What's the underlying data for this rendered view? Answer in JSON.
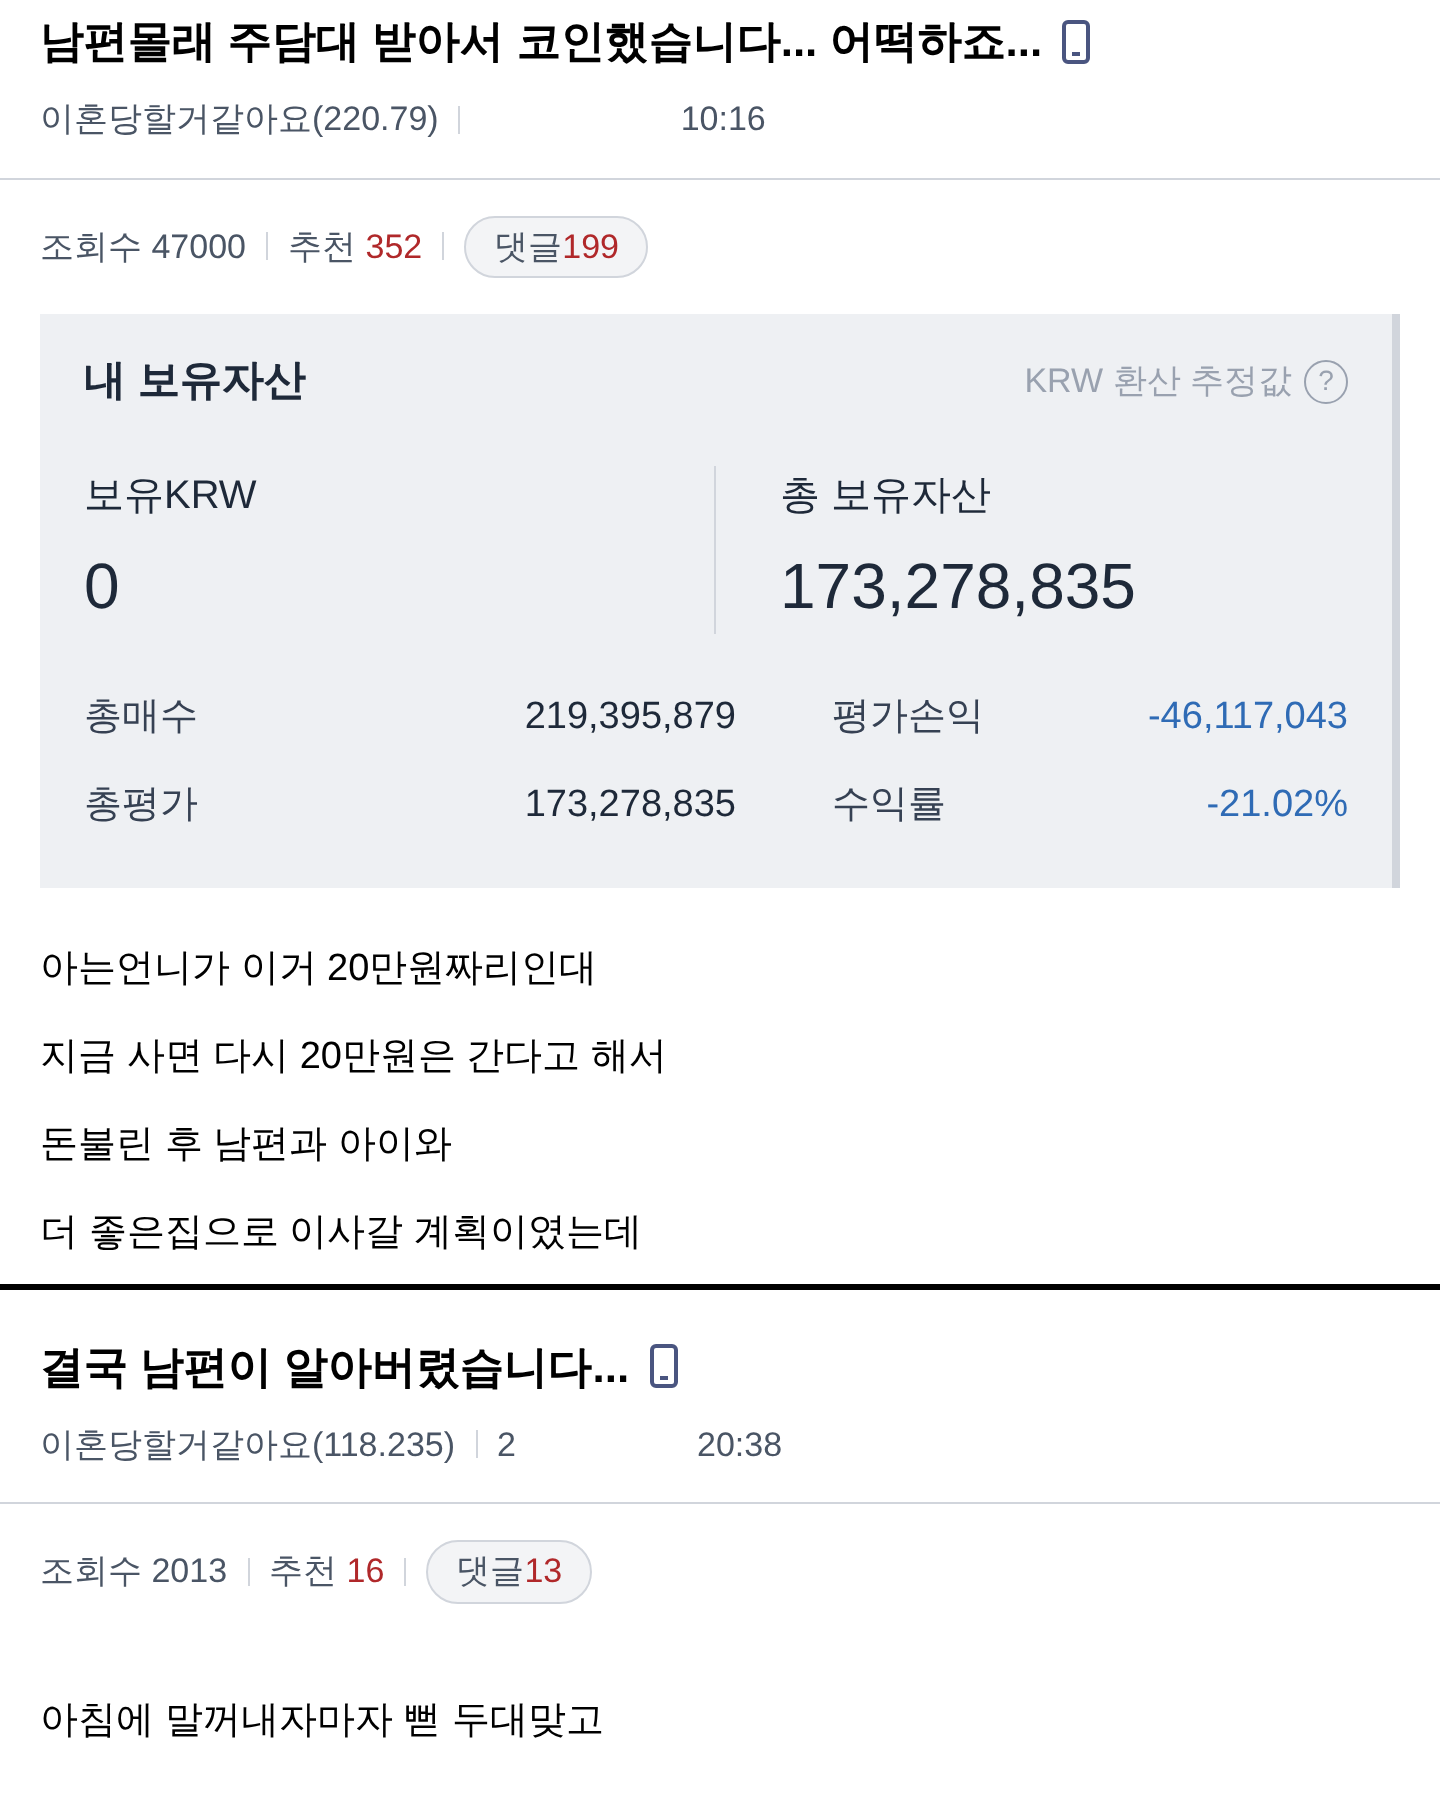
{
  "posts": [
    {
      "title": "남편몰래 주담대 받아서 코인했습니다... 어떡하죠...",
      "author": "이혼당할거같아요(220.79)",
      "time": "10:16",
      "views_label": "조회수",
      "views": "47000",
      "likes_label": "추천",
      "likes": "352",
      "comments_label": "댓글",
      "comments": "199",
      "asset_card": {
        "title": "내 보유자산",
        "note": "KRW 환산 추정값",
        "help": "?",
        "krw_label": "보유KRW",
        "krw_value": "0",
        "total_label": "총 보유자산",
        "total_value": "173,278,835",
        "rows": [
          {
            "label": "총매수",
            "value": "219,395,879",
            "label2": "평가손익",
            "value2": "-46,117,043"
          },
          {
            "label": "총평가",
            "value": "173,278,835",
            "label2": "수익률",
            "value2": "-21.02%"
          }
        ]
      },
      "body": [
        "아는언니가 이거 20만원짜리인대",
        "지금 사면 다시 20만원은 간다고 해서",
        "돈불린 후 남편과 아이와",
        "더 좋은집으로 이사갈 계획이였는데"
      ]
    },
    {
      "title": "결국 남편이 알아버렸습니다...",
      "author": "이혼당할거같아요(118.235)",
      "date_fragment": "2",
      "time": "20:38",
      "views_label": "조회수",
      "views": "2013",
      "likes_label": "추천",
      "likes": "16",
      "comments_label": "댓글",
      "comments": "13",
      "body": [
        "아침에 말꺼내자마자 뻗  두대맞고"
      ]
    }
  ]
}
